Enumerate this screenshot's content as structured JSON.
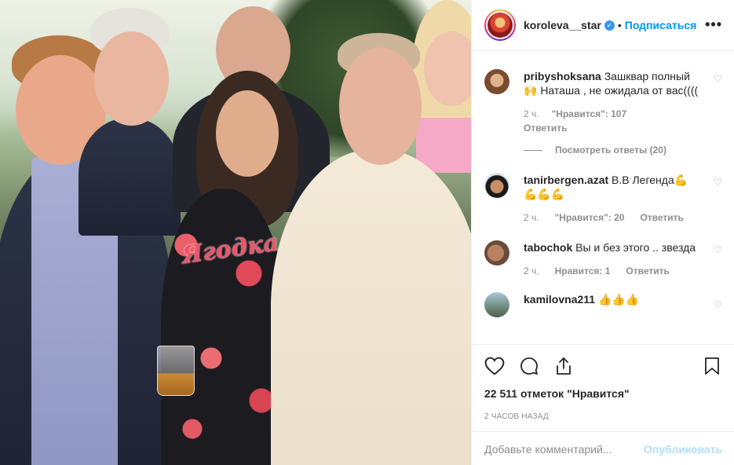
{
  "header": {
    "username": "koroleva__star",
    "follow_label": "Подписаться",
    "separator": "•",
    "more_label": "•••",
    "verified_icon": "checkmark-badge-icon"
  },
  "photo": {
    "shirt_text": "Ягодка"
  },
  "comments": [
    {
      "user": "pribyshoksana",
      "text": "Зашквар полный 🙌 Наташа , не ожидала от вас((((",
      "time": "2 ч.",
      "likes": "\"Нравится\": 107",
      "reply": "Ответить",
      "view_replies": "Посмотреть ответы (20)"
    },
    {
      "user": "tanirbergen.azat",
      "text": "В.В Легенда💪💪💪💪",
      "time": "2 ч.",
      "likes": "\"Нравится\": 20",
      "reply": "Ответить"
    },
    {
      "user": "tabochok",
      "text": "Вы и без этого .. звезда",
      "time": "2 ч.",
      "likes": "Нравится: 1",
      "reply": "Ответить"
    },
    {
      "user": "kamilovna211",
      "text": "👍👍👍"
    }
  ],
  "actions": {
    "likes_count": "22 511 отметок \"Нравится\"",
    "time_ago": "2 ЧАСОВ НАЗАД"
  },
  "add_comment": {
    "placeholder": "Добавьте комментарий...",
    "publish_label": "Опубликовать"
  },
  "colors": {
    "link_blue": "#0095f6",
    "publish_disabled": "#b2dffc",
    "muted": "#8e8e8e",
    "text": "#262626"
  }
}
